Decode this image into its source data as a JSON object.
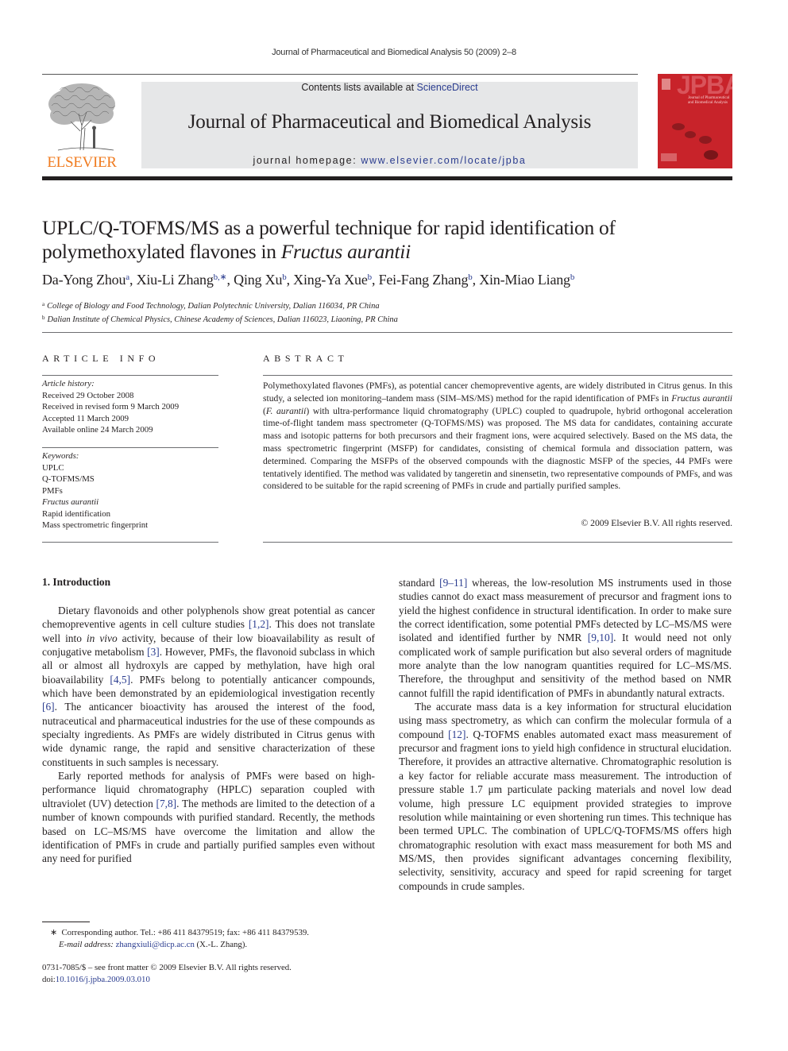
{
  "running_head": "Journal of Pharmaceutical and Biomedical Analysis 50 (2009) 2–8",
  "masthead": {
    "publisher_logo_text": "ELSEVIER",
    "contents_prefix": "Contents lists available at ",
    "contents_link": "ScienceDirect",
    "journal_name": "Journal of Pharmaceutical and Biomedical Analysis",
    "homepage_prefix": "journal homepage: ",
    "homepage_link": "www.elsevier.com/locate/jpba",
    "cover_title": "JPBA",
    "cover_subtitle_1": "Journal of Pharmaceutical",
    "cover_subtitle_2": "and Biomedical Analysis",
    "colors": {
      "publisher_orange": "#f07b1f",
      "cover_red": "#c8232a",
      "masthead_gray": "#e6e7e8",
      "link_blue": "#2a3c8f"
    }
  },
  "article": {
    "title_line_1": "UPLC/Q-TOFMS/MS as a powerful technique for rapid identification of",
    "title_line_2_prefix": "polymethoxylated flavones in ",
    "title_line_2_italic": "Fructus aurantii",
    "authors": [
      {
        "name": "Da-Yong Zhou",
        "sup": "a"
      },
      {
        "name": "Xiu-Li Zhang",
        "sup": "b,∗"
      },
      {
        "name": "Qing Xu",
        "sup": "b"
      },
      {
        "name": "Xing-Ya Xue",
        "sup": "b"
      },
      {
        "name": "Fei-Fang Zhang",
        "sup": "b"
      },
      {
        "name": "Xin-Miao Liang",
        "sup": "b"
      }
    ],
    "affiliations": [
      {
        "mark": "a",
        "text": "College of Biology and Food Technology, Dalian Polytechnic University, Dalian 116034, PR China"
      },
      {
        "mark": "b",
        "text": "Dalian Institute of Chemical Physics, Chinese Academy of Sciences, Dalian 116023, Liaoning, PR China"
      }
    ]
  },
  "article_info": {
    "heading": "ARTICLE INFO",
    "history_label": "Article history:",
    "history": [
      "Received 29 October 2008",
      "Received in revised form 9 March 2009",
      "Accepted 11 March 2009",
      "Available online 24 March 2009"
    ],
    "keywords_label": "Keywords:",
    "keywords": [
      "UPLC",
      "Q-TOFMS/MS",
      "PMFs",
      "Fructus aurantii",
      "Rapid identification",
      "Mass spectrometric fingerprint"
    ]
  },
  "abstract": {
    "heading": "ABSTRACT",
    "p1": "Polymethoxylated flavones (PMFs), as potential cancer chemopreventive agents, are widely distributed in Citrus genus. In this study, a selected ion monitoring–tandem mass (SIM–MS/MS) method for the rapid identification of PMFs in ",
    "italic1": "Fructus aurantii",
    "p2": " (",
    "italic2": "F. aurantii",
    "p3": ") with ultra-performance liquid chromatography (UPLC) coupled to quadrupole, hybrid orthogonal acceleration time-of-flight tandem mass spectrometer (Q-TOFMS/MS) was proposed. The MS data for candidates, containing accurate mass and isotopic patterns for both precursors and their fragment ions, were acquired selectively. Based on the MS data, the mass spectrometric fingerprint (MSFP) for candidates, consisting of chemical formula and dissociation pattern, was determined. Comparing the MSFPs of the observed compounds with the diagnostic MSFP of the species, 44 PMFs were tentatively identified. The method was validated by tangeretin and sinensetin, two representative compounds of PMFs, and was considered to be suitable for the rapid screening of PMFs in crude and partially purified samples.",
    "copyright": "© 2009 Elsevier B.V. All rights reserved."
  },
  "intro": {
    "heading": "1.  Introduction",
    "left_p1": [
      {
        "t": "Dietary flavonoids and other polyphenols show great potential as cancer chemopreventive agents in cell culture studies "
      },
      {
        "ref": "[1,2]"
      },
      {
        "t": ". This does not translate well into "
      },
      {
        "i": "in vivo"
      },
      {
        "t": " activity, because of their low bioavailability as result of conjugative metabolism "
      },
      {
        "ref": "[3]"
      },
      {
        "t": ". However, PMFs, the flavonoid subclass in which all or almost all hydroxyls are capped by methylation, have high oral bioavailability "
      },
      {
        "ref": "[4,5]"
      },
      {
        "t": ". PMFs belong to potentially anticancer compounds, which have been demonstrated by an epidemiological investigation recently "
      },
      {
        "ref": "[6]"
      },
      {
        "t": ". The anticancer bioactivity has aroused the interest of the food, nutraceutical and pharmaceutical industries for the use of these compounds as specialty ingredients. As PMFs are widely distributed in Citrus genus with wide dynamic range, the rapid and sensitive characterization of these constituents in such samples is necessary."
      }
    ],
    "left_p2": [
      {
        "t": "Early reported methods for analysis of PMFs were based on high-performance liquid chromatography (HPLC) separation coupled with ultraviolet (UV) detection "
      },
      {
        "ref": "[7,8]"
      },
      {
        "t": ". The methods are limited to the detection of a number of known compounds with purified standard. Recently, the methods based on LC–MS/MS have overcome the limitation and allow the identification of PMFs in crude and partially purified samples even without any need for purified"
      }
    ],
    "right_p1": [
      {
        "t": "standard "
      },
      {
        "ref": "[9–11]"
      },
      {
        "t": " whereas, the low-resolution MS instruments used in those studies cannot do exact mass measurement of precursor and fragment ions to yield the highest confidence in structural identification. In order to make sure the correct identification, some potential PMFs detected by LC–MS/MS were isolated and identified further by NMR "
      },
      {
        "ref": "[9,10]"
      },
      {
        "t": ". It would need not only complicated work of sample purification but also several orders of magnitude more analyte than the low nanogram quantities required for LC–MS/MS. Therefore, the throughput and sensitivity of the method based on NMR cannot fulfill the rapid identification of PMFs in abundantly natural extracts."
      }
    ],
    "right_p2": [
      {
        "t": "The accurate mass data is a key information for structural elucidation using mass spectrometry, as which can confirm the molecular formula of a compound "
      },
      {
        "ref": "[12]"
      },
      {
        "t": ". Q-TOFMS enables automated exact mass measurement of precursor and fragment ions to yield high confidence in structural elucidation. Therefore, it provides an attractive alternative. Chromatographic resolution is a key factor for reliable accurate mass measurement. The introduction of pressure stable 1.7 μm particulate packing materials and novel low dead volume, high pressure LC equipment provided strategies to improve resolution while maintaining or even shortening run times. This technique has been termed UPLC. The combination of UPLC/Q-TOFMS/MS offers high chromatographic resolution with exact mass measurement for both MS and MS/MS, then provides significant advantages concerning flexibility, selectivity, sensitivity, accuracy and speed for rapid screening for target compounds in crude samples."
      }
    ]
  },
  "footnotes": {
    "corresponding_mark": "∗",
    "corresponding_text": "Corresponding author. Tel.: +86 411 84379519; fax: +86 411 84379539.",
    "email_label": "E-mail address:",
    "email": "zhangxiuli@dicp.ac.cn",
    "email_suffix": " (X.-L. Zhang).",
    "front_matter": "0731-7085/$ – see front matter © 2009 Elsevier B.V. All rights reserved.",
    "doi_prefix": "doi:",
    "doi": "10.1016/j.jpba.2009.03.010"
  }
}
